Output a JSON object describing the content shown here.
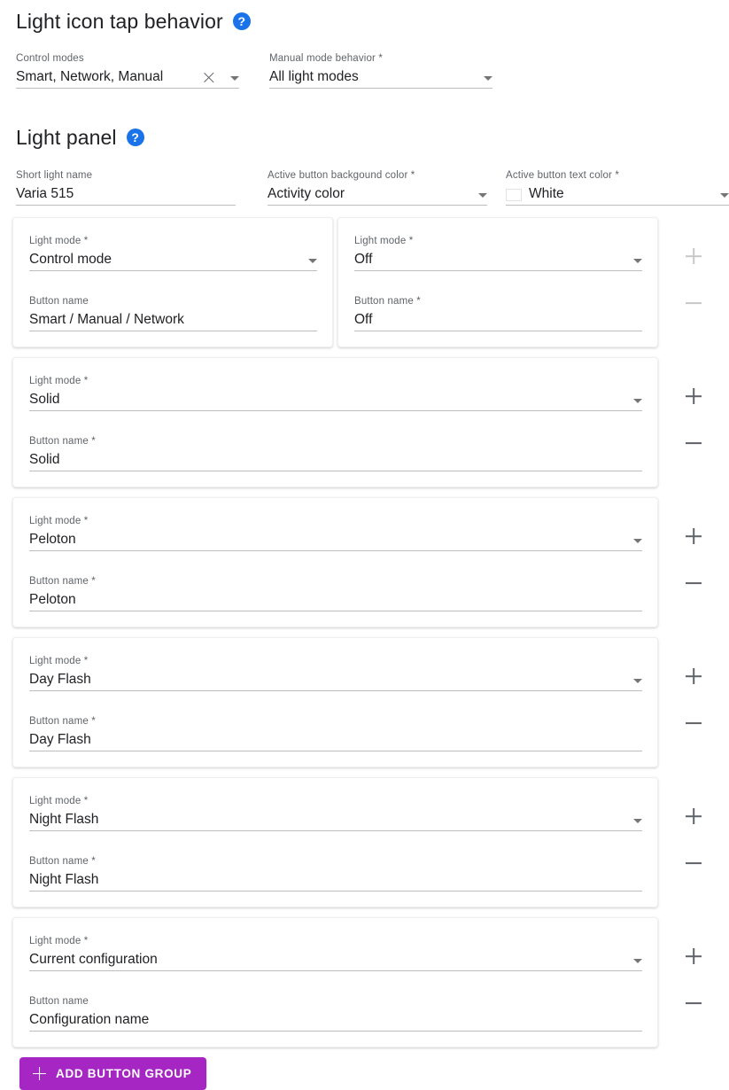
{
  "sections": {
    "tap_behavior": {
      "title": "Light icon tap behavior",
      "help_icon": "help-icon",
      "fields": {
        "control_modes": {
          "label": "Control modes",
          "value": "Smart, Network, Manual",
          "clear_icon": "close-icon",
          "caret_icon": "chevron-down-icon"
        },
        "manual_mode_behavior": {
          "label": "Manual mode behavior *",
          "value": "All light modes",
          "caret_icon": "chevron-down-icon"
        }
      }
    },
    "light_panel": {
      "title": "Light panel",
      "help_icon": "help-icon",
      "fields": {
        "short_light_name": {
          "label": "Short light name",
          "value": "Varia 515"
        },
        "active_button_background_color": {
          "label": "Active button backgound color *",
          "value": "Activity color",
          "caret_icon": "chevron-down-icon"
        },
        "active_button_text_color": {
          "label": "Active button text color *",
          "value": "White",
          "swatch_color": "#ffffff",
          "caret_icon": "chevron-down-icon"
        }
      }
    }
  },
  "button_groups": [
    {
      "split": true,
      "add_icon": "plus-icon",
      "remove_icon": "minus-icon",
      "actions_muted": true,
      "cards": [
        {
          "light_mode": {
            "label": "Light mode *",
            "value": "Control mode"
          },
          "button_name": {
            "label": "Button name",
            "value": "Smart / Manual / Network"
          }
        },
        {
          "light_mode": {
            "label": "Light mode *",
            "value": "Off"
          },
          "button_name": {
            "label": "Button name *",
            "value": "Off"
          }
        }
      ]
    },
    {
      "split": false,
      "add_icon": "plus-icon",
      "remove_icon": "minus-icon",
      "actions_muted": false,
      "cards": [
        {
          "light_mode": {
            "label": "Light mode *",
            "value": "Solid"
          },
          "button_name": {
            "label": "Button name *",
            "value": "Solid"
          }
        }
      ]
    },
    {
      "split": false,
      "add_icon": "plus-icon",
      "remove_icon": "minus-icon",
      "actions_muted": false,
      "cards": [
        {
          "light_mode": {
            "label": "Light mode *",
            "value": "Peloton"
          },
          "button_name": {
            "label": "Button name *",
            "value": "Peloton"
          }
        }
      ]
    },
    {
      "split": false,
      "add_icon": "plus-icon",
      "remove_icon": "minus-icon",
      "actions_muted": false,
      "cards": [
        {
          "light_mode": {
            "label": "Light mode *",
            "value": "Day Flash"
          },
          "button_name": {
            "label": "Button name *",
            "value": "Day Flash"
          }
        }
      ]
    },
    {
      "split": false,
      "add_icon": "plus-icon",
      "remove_icon": "minus-icon",
      "actions_muted": false,
      "cards": [
        {
          "light_mode": {
            "label": "Light mode *",
            "value": "Night Flash"
          },
          "button_name": {
            "label": "Button name *",
            "value": "Night Flash"
          }
        }
      ]
    },
    {
      "split": false,
      "add_icon": "plus-icon",
      "remove_icon": "minus-icon",
      "actions_muted": false,
      "cards": [
        {
          "light_mode": {
            "label": "Light mode *",
            "value": "Current configuration"
          },
          "button_name": {
            "label": "Button name",
            "value": "Configuration name"
          }
        }
      ]
    }
  ],
  "add_button_group": {
    "label": "ADD BUTTON GROUP",
    "icon": "plus-icon",
    "color": "#a626c4"
  },
  "help_glyph": "?"
}
